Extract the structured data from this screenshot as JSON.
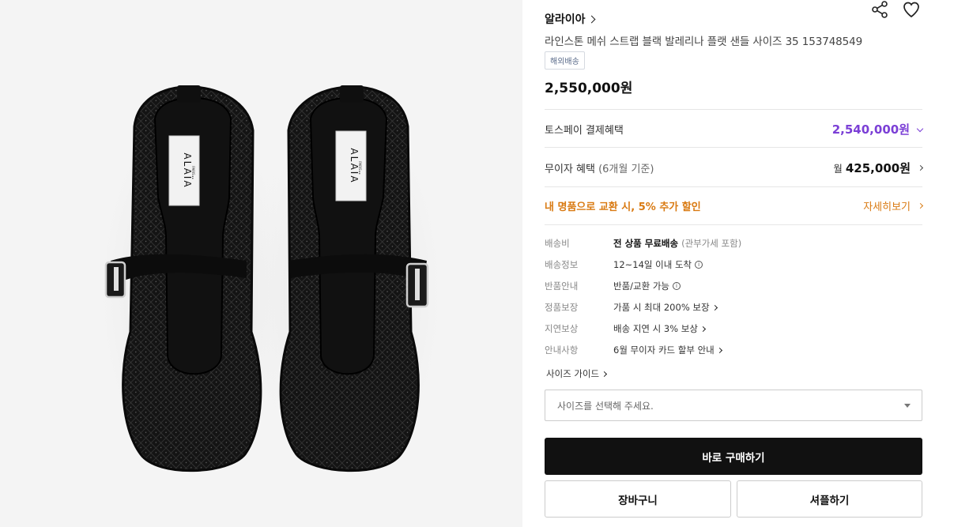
{
  "product": {
    "brand": "알라이아",
    "title": "라인스톤 메쉬 스트랩 블랙 발레리나 플랫 샌들 사이즈 35 153748549",
    "badge": "해외배송",
    "price": "2,550,000원",
    "insole_logo": "ALAÏA",
    "insole_sub": "PARIS"
  },
  "benefits": {
    "toss_label": "토스페이 결제혜택",
    "toss_price": "2,540,000원",
    "interest_label": "무이자 혜택",
    "interest_sub": "(6개월 기준)",
    "interest_month": "월",
    "interest_price": "425,000원",
    "trade_label": "내 명품으로 교환 시, 5% 추가 할인",
    "trade_link": "자세히보기"
  },
  "specs": [
    {
      "key": "배송비",
      "value_bold": "전 상품 무료배송",
      "value_muted": "(관부가세 포함)"
    },
    {
      "key": "배송정보",
      "value": "12~14일 이내 도착"
    },
    {
      "key": "반품안내",
      "value": "반품/교환 가능"
    },
    {
      "key": "정품보장",
      "value": "가품 시 최대 200% 보장"
    },
    {
      "key": "지연보상",
      "value": "배송 지연 시 3% 보상"
    },
    {
      "key": "안내사항",
      "value": "6월 무이자 카드 할부 안내"
    }
  ],
  "size": {
    "guide_label": "사이즈 가이드",
    "placeholder": "사이즈를 선택해 주세요."
  },
  "actions": {
    "buy": "바로 구매하기",
    "cart": "장바구니",
    "present": "셔플하기"
  },
  "icons": {
    "share": "share-icon",
    "wishlist": "heart-icon",
    "info": "info-icon",
    "chevron": "chevron-right-icon",
    "dropdown": "caret-down-icon"
  },
  "colors": {
    "toss_accent": "#7b3fd6",
    "trade_accent": "#d97a12",
    "buy_button": "#111111"
  }
}
